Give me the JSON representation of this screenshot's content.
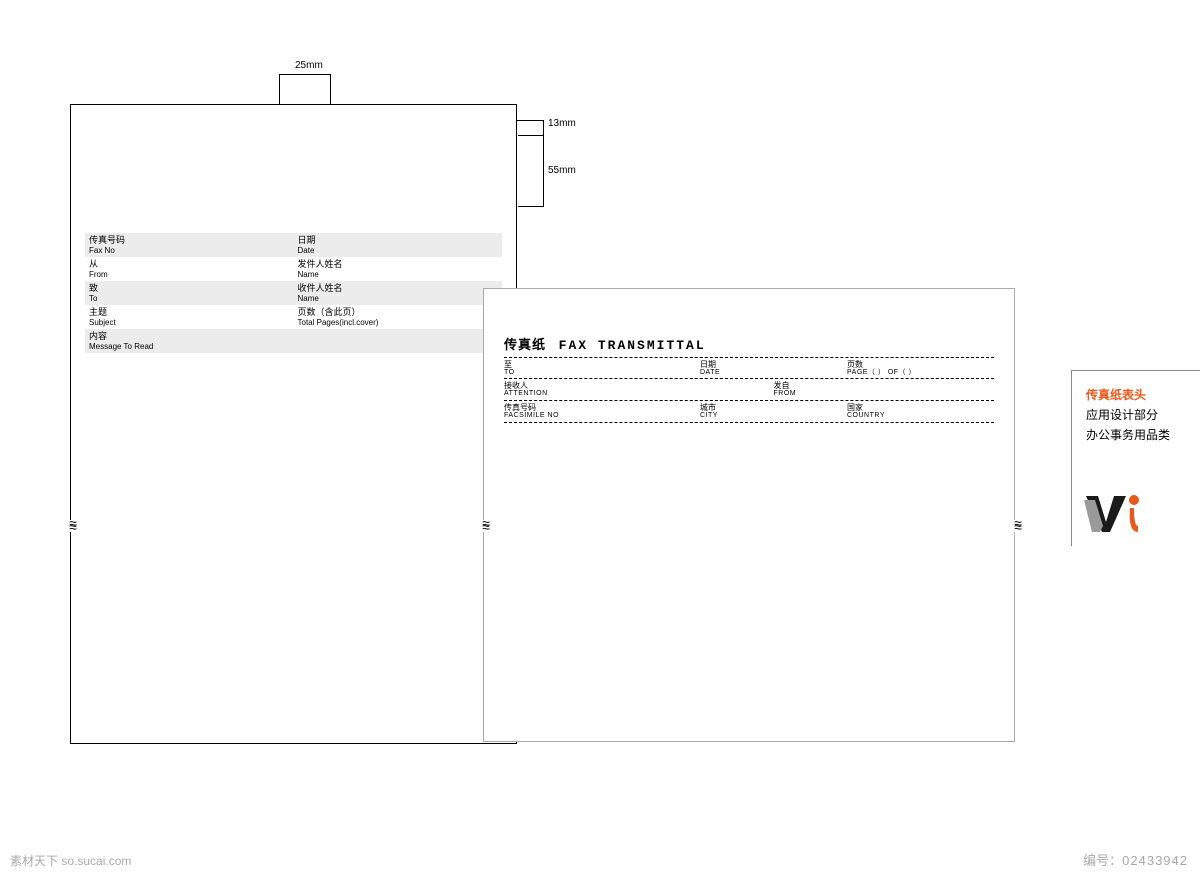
{
  "dimensions": {
    "d25": "25mm",
    "d13": "13mm",
    "d55": "55mm"
  },
  "left_page": {
    "rows": [
      {
        "shade": true,
        "l_cn": "传真号码",
        "l_en": "Fax No",
        "r_cn": "日期",
        "r_en": "Date"
      },
      {
        "shade": false,
        "l_cn": "从",
        "l_en": "From",
        "r_cn": "发件人姓名",
        "r_en": "Name"
      },
      {
        "shade": true,
        "l_cn": "致",
        "l_en": "To",
        "r_cn": "收件人姓名",
        "r_en": "Name"
      },
      {
        "shade": false,
        "l_cn": "主题",
        "l_en": "Subject",
        "r_cn": "页数（含此页）",
        "r_en": "Total Pages(incl.cover)"
      },
      {
        "shade": true,
        "l_cn": "内容",
        "l_en": "Message To Read",
        "r_cn": "",
        "r_en": ""
      }
    ]
  },
  "right_page": {
    "title_cn": "传真纸",
    "title_en": "FAX TRANSMITTAL",
    "rows": [
      [
        {
          "cn": "至",
          "en": "TO"
        },
        {
          "cn": "日期",
          "en": "DATE"
        },
        {
          "cn": "页数",
          "en": "PAGE（  ）        OF（  ）"
        }
      ],
      [
        {
          "cn": "接收人",
          "en": "ATTENTION"
        },
        {
          "cn": "发自",
          "en": "FROM"
        }
      ],
      [
        {
          "cn": "传真号码",
          "en": "FACSIMILE NO"
        },
        {
          "cn": "城市",
          "en": "CITY"
        },
        {
          "cn": "国家",
          "en": "COUNTRY"
        }
      ]
    ]
  },
  "info_card": {
    "title": "传真纸表头",
    "line1": "应用设计部分",
    "line2": "办公事务用品类"
  },
  "watermark": {
    "left": "素材天下 so.sucai.com",
    "right_label": "编号：",
    "right_value": "02433942"
  }
}
